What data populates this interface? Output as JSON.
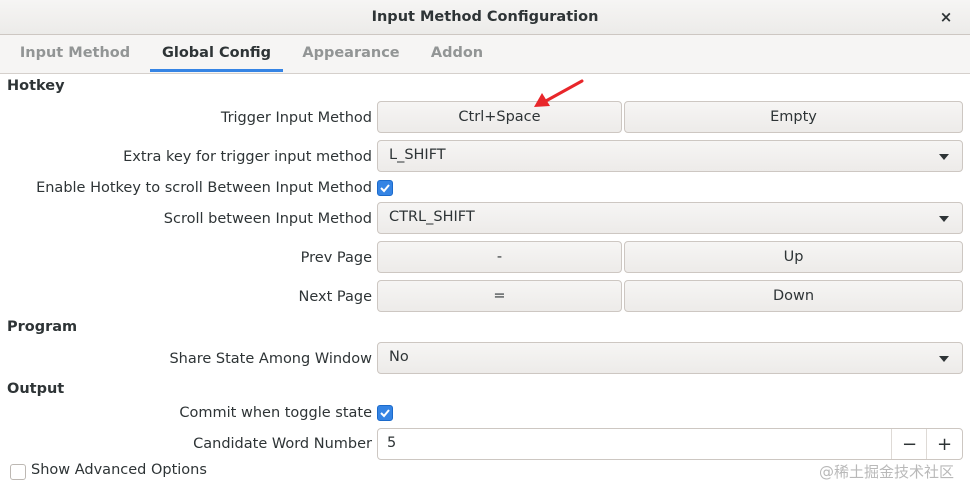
{
  "window": {
    "title": "Input Method Configuration",
    "close_glyph": "×"
  },
  "tabs": [
    {
      "label": "Input Method",
      "active": false
    },
    {
      "label": "Global Config",
      "active": true
    },
    {
      "label": "Appearance",
      "active": false
    },
    {
      "label": "Addon",
      "active": false
    }
  ],
  "hotkey": {
    "section_title": "Hotkey",
    "trigger": {
      "label": "Trigger Input Method",
      "key1": "Ctrl+Space",
      "key2": "Empty"
    },
    "extra_key": {
      "label": "Extra key for trigger input method",
      "value": "L_SHIFT"
    },
    "enable_scroll": {
      "label": "Enable Hotkey to scroll Between Input Method",
      "checked": true
    },
    "scroll_between": {
      "label": "Scroll between Input Method",
      "value": "CTRL_SHIFT"
    },
    "prev_page": {
      "label": "Prev Page",
      "key1": "-",
      "key2": "Up"
    },
    "next_page": {
      "label": "Next Page",
      "key1": "=",
      "key2": "Down"
    }
  },
  "program": {
    "section_title": "Program",
    "share_state": {
      "label": "Share State Among Window",
      "value": "No"
    }
  },
  "output": {
    "section_title": "Output",
    "commit_toggle": {
      "label": "Commit when toggle state",
      "checked": true
    },
    "candidate_number": {
      "label": "Candidate Word Number",
      "value": "5",
      "minus": "−",
      "plus": "+"
    }
  },
  "show_advanced": {
    "label": "Show Advanced Options",
    "checked": false
  },
  "watermark": "@稀土掘金技术社区",
  "colors": {
    "accent": "#3584e4",
    "annotation_arrow": "#e8262a"
  }
}
